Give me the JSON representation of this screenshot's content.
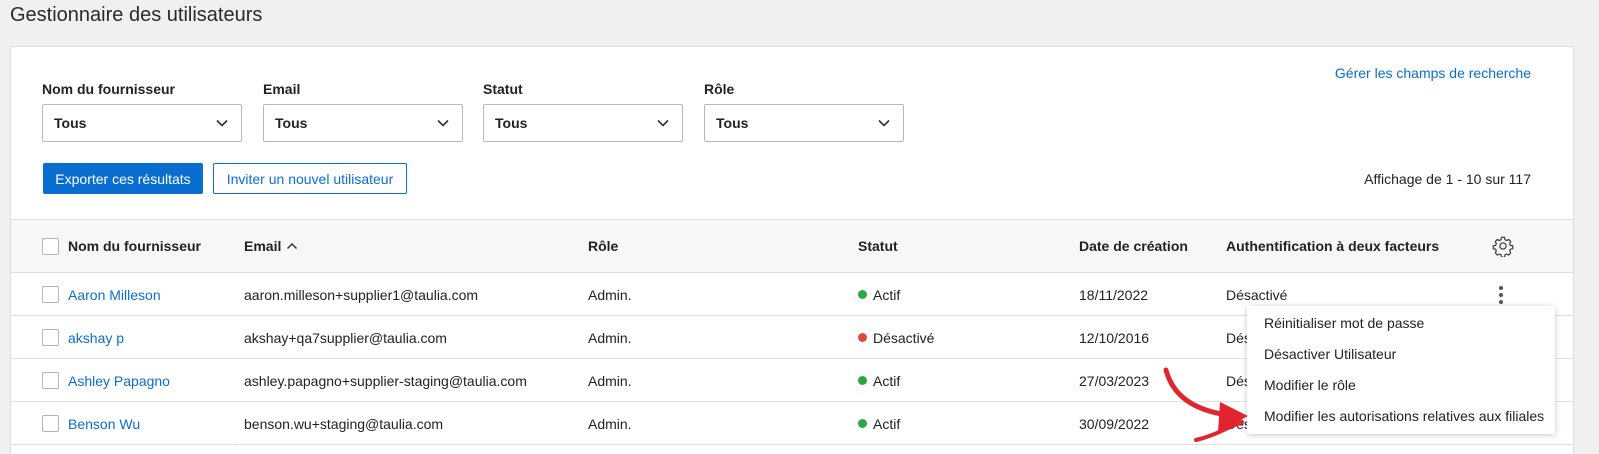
{
  "page": {
    "title": "Gestionnaire des utilisateurs"
  },
  "links": {
    "manage_search_fields": "Gérer les champs de recherche"
  },
  "filters": [
    {
      "label": "Nom du fournisseur",
      "value": "Tous"
    },
    {
      "label": "Email",
      "value": "Tous"
    },
    {
      "label": "Statut",
      "value": "Tous"
    },
    {
      "label": "Rôle",
      "value": "Tous"
    }
  ],
  "actions": {
    "export_label": "Exporter ces résultats",
    "invite_label": "Inviter un nouvel utilisateur"
  },
  "results": {
    "count_text": "Affichage de 1 - 10 sur 117"
  },
  "table": {
    "headers": {
      "name": "Nom du fournisseur",
      "email": "Email",
      "role": "Rôle",
      "status": "Statut",
      "created": "Date de création",
      "twofa": "Authentification à deux facteurs"
    },
    "sort": {
      "column": "email",
      "direction": "ascending",
      "icon": "chevron-up-icon"
    },
    "rows": [
      {
        "name": "Aaron Milleson",
        "email": "aaron.milleson+supplier1@taulia.com",
        "role": "Admin.",
        "status": "Actif",
        "status_color": "#2aa845",
        "created": "18/11/2022",
        "twofa": "Désactivé"
      },
      {
        "name": "akshay p",
        "email": "akshay+qa7supplier@taulia.com",
        "role": "Admin.",
        "status": "Désactivé",
        "status_color": "#e04848",
        "created": "12/10/2016",
        "twofa": "Dés"
      },
      {
        "name": "Ashley Papagno",
        "email": "ashley.papagno+supplier-staging@taulia.com",
        "role": "Admin.",
        "status": "Actif",
        "status_color": "#2aa845",
        "created": "27/03/2023",
        "twofa": "Dés"
      },
      {
        "name": "Benson Wu",
        "email": "benson.wu+staging@taulia.com",
        "role": "Admin.",
        "status": "Actif",
        "status_color": "#2aa845",
        "created": "30/09/2022",
        "twofa": "Dés"
      }
    ]
  },
  "context_menu": {
    "items": [
      "Réinitialiser mot de passe",
      "Désactiver Utilisateur",
      "Modifier le rôle",
      "Modifier les autorisations relatives aux filiales"
    ]
  },
  "colors": {
    "accent": "#0a6ed1",
    "active": "#2aa845",
    "inactive": "#e04848",
    "annotation_arrow": "#e0252f"
  }
}
